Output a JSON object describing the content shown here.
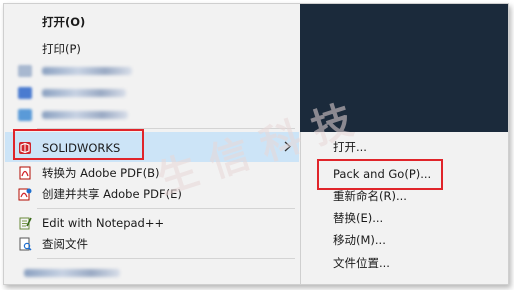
{
  "menu": {
    "open": "打开(O)",
    "print": "打印(P)",
    "solidworks": "SOLIDWORKS",
    "convert_pdf": "转换为 Adobe PDF(B)",
    "create_share_pdf": "创建并共享 Adobe PDF(E)",
    "notepad": "Edit with Notepad++",
    "view_file": "查阅文件"
  },
  "submenu": {
    "open": "打开...",
    "pack_and_go": "Pack and Go(P)...",
    "rename": "重新命名(R)...",
    "replace": "替换(E)...",
    "move": "移动(M)...",
    "file_location": "文件位置..."
  },
  "watermark": "生信科技",
  "colors": {
    "highlight": "#cce4f7",
    "annotation_red": "#e0242a",
    "desktop": "#1b2a3b"
  }
}
